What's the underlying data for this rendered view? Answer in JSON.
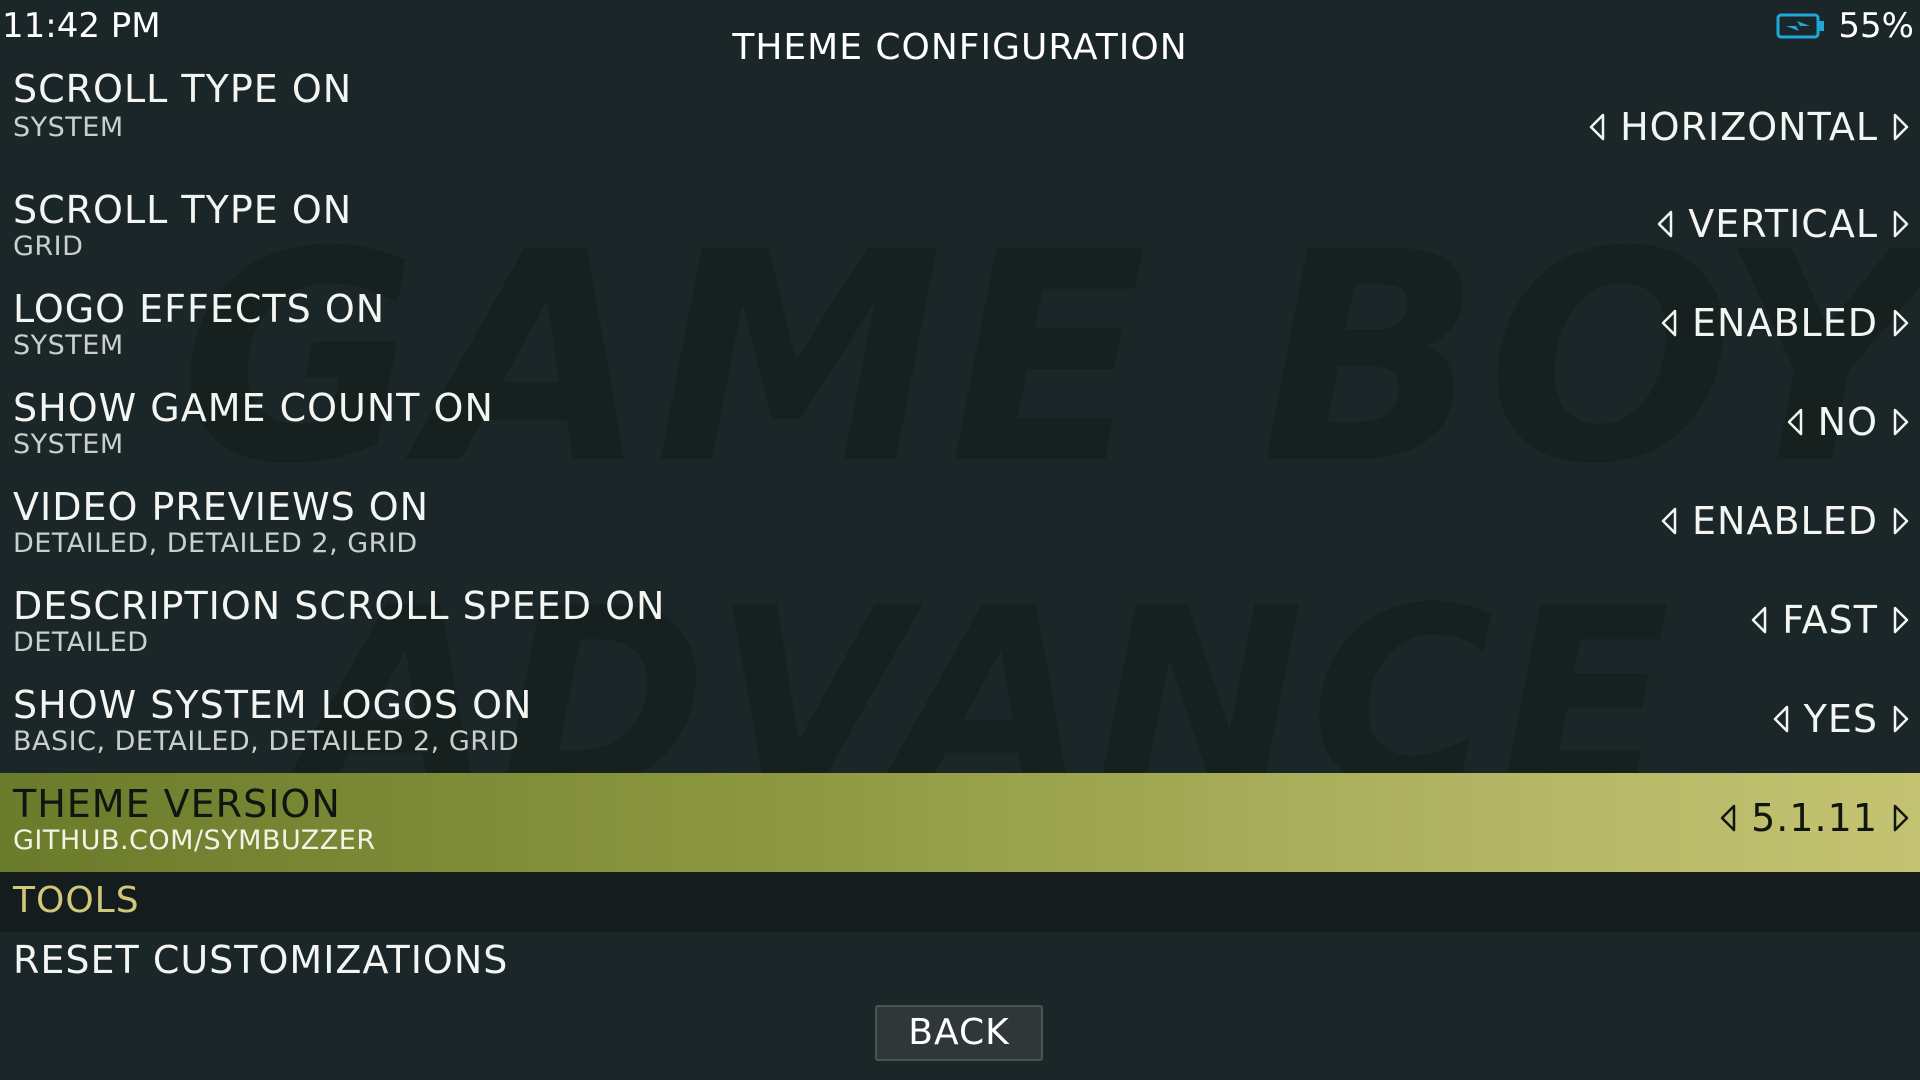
{
  "status_bar": {
    "time": "11:42 PM",
    "battery_percent": "55%",
    "battery_icon": "battery-charging-icon",
    "accent_color": "#1fa7d9"
  },
  "header": {
    "title": "THEME CONFIGURATION"
  },
  "background": {
    "watermark_line_1": "GAME BOY",
    "watermark_line_2": "ADVANCE"
  },
  "settings": {
    "items": [
      {
        "label": "SCROLL TYPE ON",
        "sub": "SYSTEM",
        "value": "HORIZONTAL"
      },
      {
        "label": "SCROLL TYPE ON",
        "sub": "GRID",
        "value": "VERTICAL"
      },
      {
        "label": "LOGO EFFECTS ON",
        "sub": "SYSTEM",
        "value": "ENABLED"
      },
      {
        "label": "SHOW GAME COUNT ON",
        "sub": "SYSTEM",
        "value": "NO"
      },
      {
        "label": "VIDEO PREVIEWS ON",
        "sub": "DETAILED, DETAILED 2, GRID",
        "value": "ENABLED"
      },
      {
        "label": "DESCRIPTION SCROLL SPEED ON",
        "sub": "DETAILED",
        "value": "FAST"
      },
      {
        "label": "SHOW SYSTEM LOGOS ON",
        "sub": "BASIC, DETAILED, DETAILED 2, GRID",
        "value": "YES"
      },
      {
        "label": "THEME VERSION",
        "sub": "GITHUB.COM/SYMBUZZER",
        "value": "5.1.11",
        "selected": true
      }
    ],
    "selected_color": "#8c9740"
  },
  "tools": {
    "header": "TOOLS",
    "reset_label": "RESET CUSTOMIZATIONS"
  },
  "footer": {
    "back_label": "BACK"
  }
}
